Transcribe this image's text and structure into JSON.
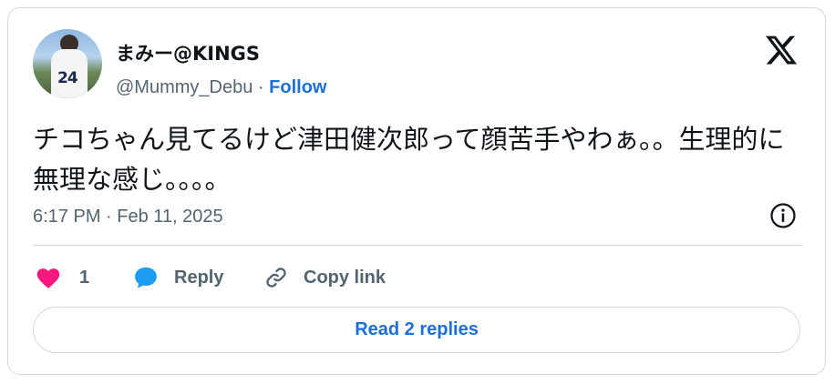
{
  "author": {
    "display_name": "まみー@KINGS",
    "handle": "@Mummy_Debu",
    "separator": "·",
    "follow_label": "Follow",
    "avatar_jersey_number": "24"
  },
  "tweet": {
    "text": "チコちゃん見てるけど津田健次郎って顔苦手やわぁ。。生理的に無理な感じ。。。。",
    "timestamp": "6:17 PM · Feb 11, 2025"
  },
  "actions": {
    "like_count": "1",
    "reply_label": "Reply",
    "copy_link_label": "Copy link",
    "read_replies_label": "Read 2 replies"
  },
  "icons": {
    "brand": "x-logo-icon",
    "info": "info-icon",
    "like": "heart-icon",
    "reply": "speech-bubble-icon",
    "copy": "link-icon"
  },
  "colors": {
    "accent": "#1d6fd8",
    "heart": "#f91880",
    "reply_bubble": "#1d9bf0",
    "muted": "#536471",
    "border": "#cfd9de"
  }
}
